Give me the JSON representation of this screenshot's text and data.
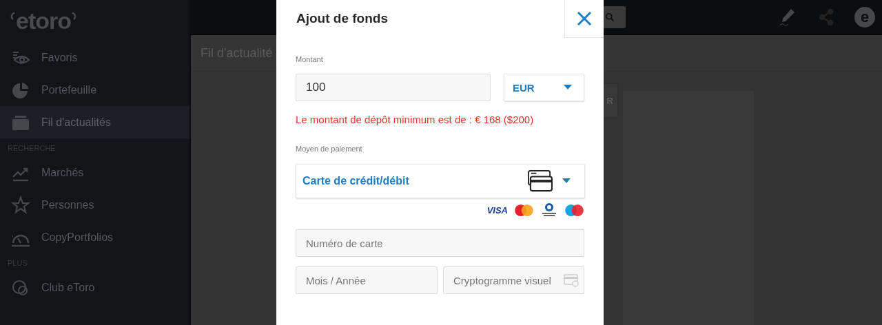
{
  "app": {
    "logo": "etoro",
    "avatar_logo": "e"
  },
  "sidebar": {
    "sections": [
      {
        "items": [
          {
            "label": "Favoris",
            "selected": false
          },
          {
            "label": "Portefeuille",
            "selected": false
          },
          {
            "label": "Fil d'actualités",
            "selected": true
          }
        ]
      },
      {
        "heading": "RECHERCHE",
        "items": [
          {
            "label": "Marchés",
            "selected": false
          },
          {
            "label": "Personnes",
            "selected": false
          },
          {
            "label": "CopyPortfolios",
            "selected": false
          }
        ]
      },
      {
        "heading": "PLUS",
        "items": [
          {
            "label": "Club eToro",
            "selected": false
          }
        ]
      }
    ]
  },
  "page": {
    "title": "Fil d'actualité",
    "card_fragment": "R"
  },
  "dialog": {
    "title": "Ajout de fonds",
    "amount": {
      "label": "Montant",
      "value": "100"
    },
    "currency": {
      "value": "EUR"
    },
    "error": "Le montant de dépôt minimum est de : € 168 ($200)",
    "payment": {
      "label": "Moyen de paiement",
      "method": "Carte de crédit/débit",
      "visa": "VISA"
    },
    "card_number": {
      "placeholder": "Numéro de carte"
    },
    "expiry": {
      "placeholder": "Mois / Année"
    },
    "cvv": {
      "placeholder": "Cryptogramme visuel"
    }
  }
}
